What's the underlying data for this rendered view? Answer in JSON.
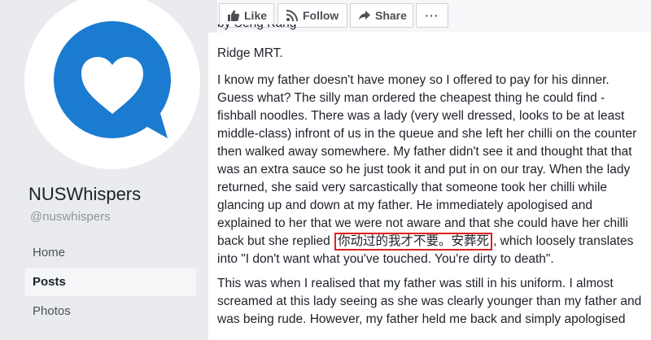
{
  "page": {
    "name": "NUSWhispers",
    "handle": "@nuswhispers"
  },
  "nav": {
    "items": [
      {
        "label": "Home",
        "active": false
      },
      {
        "label": "Posts",
        "active": true
      },
      {
        "label": "Photos",
        "active": false
      }
    ]
  },
  "actions": {
    "like": "Like",
    "follow": "Follow",
    "share": "Share",
    "more": "···"
  },
  "post": {
    "cut_top": "… Ridge MRT.",
    "lines": [
      "Ridge MRT.",
      "I know my father doesn't have money so I offered to pay for his dinner.",
      "Guess what? The silly man ordered the cheapest thing he could find -",
      "fishball noodles. There was a lady (very well dressed, looks to be at least",
      "middle-class) infront of us in the queue and she left her chilli on the counter",
      "then walked away somewhere. My father didn't see it and thought that that",
      "was an extra sauce so he just took it and put in on our tray. When the lady",
      "returned, she said very sarcastically that someone took her chilli while",
      "glancing up and down at my father. He immediately apologised and",
      "explained to her that we were not aware and that she could have her chilli"
    ],
    "quote_prefix": "back but she replied",
    "quote_chinese": "你动过的我才不要。安葬死",
    "quote_suffix": ", which loosely translates",
    "translation_line": "into \"I don't want what you've touched. You're dirty to death\".",
    "para2": [
      "This was when I realised that my father was still in his uniform. I almost",
      "screamed at this lady seeing as she was clearly younger than my father and",
      "was being rude. However, my father held me back and simply apologised"
    ]
  },
  "colors": {
    "brand_blue": "#1a7bd0",
    "highlight_red": "#e02020",
    "background": "#e9ebee"
  }
}
